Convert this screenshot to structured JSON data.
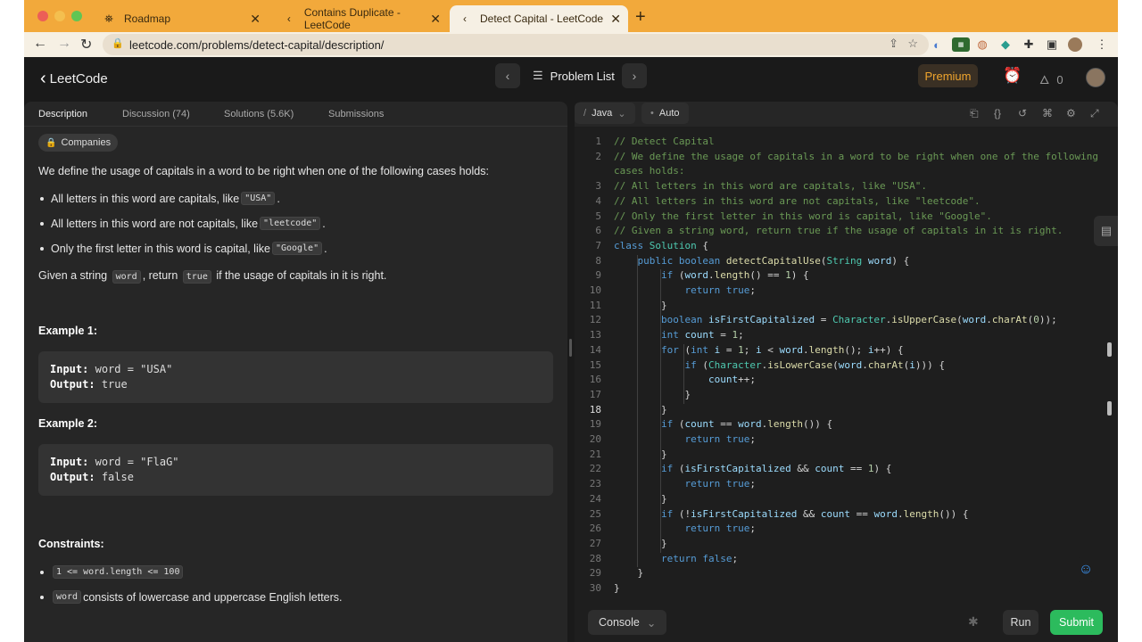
{
  "browser": {
    "tabs": [
      {
        "title": "Roadmap",
        "icon": "roadmap-icon"
      },
      {
        "title": "Contains Duplicate - LeetCode",
        "icon": "leetcode-icon"
      },
      {
        "title": "Detect Capital - LeetCode",
        "icon": "leetcode-icon",
        "active": true
      }
    ],
    "url": "leetcode.com/problems/detect-capital/description/"
  },
  "nav": {
    "logo": "LeetCode",
    "problem_list": "Problem List",
    "premium": "Premium",
    "streak": "0"
  },
  "description": {
    "tabs": [
      "Description",
      "Discussion (74)",
      "Solutions (5.6K)",
      "Submissions"
    ],
    "companies": "Companies",
    "intro": "We define the usage of capitals in a word to be right when one of the following cases holds:",
    "bullets": [
      {
        "pre": "All letters in this word are capitals, like ",
        "code": "\"USA\"",
        "post": "."
      },
      {
        "pre": "All letters in this word are not capitals, like ",
        "code": "\"leetcode\"",
        "post": "."
      },
      {
        "pre": "Only the first letter in this word is capital, like ",
        "code": "\"Google\"",
        "post": "."
      }
    ],
    "given": {
      "pre": "Given a string ",
      "code1": "word",
      "mid": ", return ",
      "code2": "true",
      "post": " if the usage of capitals in it is right."
    },
    "example1": {
      "title": "Example 1:",
      "input_label": "Input:",
      "input": "word = \"USA\"",
      "output_label": "Output:",
      "output": "true"
    },
    "example2": {
      "title": "Example 2:",
      "input_label": "Input:",
      "input": "word = \"FlaG\"",
      "output_label": "Output:",
      "output": "false"
    },
    "constraints": {
      "title": "Constraints:",
      "c1": "1 <= word.length <= 100",
      "c2_code": "word",
      "c2_text": " consists of lowercase and uppercase English letters."
    }
  },
  "editor": {
    "language": "Java",
    "auto": "Auto",
    "current_line": 18,
    "console": "Console",
    "run": "Run",
    "submit": "Submit",
    "accent_submit": "#2cbb5d",
    "lines": [
      {
        "n": "1",
        "t": "// Detect Capital"
      },
      {
        "n": "2",
        "t": "// We define the usage of capitals in a word to be right when one of the following"
      },
      {
        "n": "",
        "t": "cases holds:"
      },
      {
        "n": "3",
        "t": "// All letters in this word are capitals, like \"USA\"."
      },
      {
        "n": "4",
        "t": "// All letters in this word are not capitals, like \"leetcode\"."
      },
      {
        "n": "5",
        "t": "// Only the first letter in this word is capital, like \"Google\"."
      },
      {
        "n": "6",
        "t": "// Given a string word, return true if the usage of capitals in it is right."
      },
      {
        "n": "7",
        "t": "class Solution {"
      },
      {
        "n": "8",
        "t": "    public boolean detectCapitalUse(String word) {"
      },
      {
        "n": "9",
        "t": "        if (word.length() == 1) {"
      },
      {
        "n": "10",
        "t": "            return true;"
      },
      {
        "n": "11",
        "t": "        }"
      },
      {
        "n": "12",
        "t": "        boolean isFirstCapitalized = Character.isUpperCase(word.charAt(0));"
      },
      {
        "n": "13",
        "t": "        int count = 1;"
      },
      {
        "n": "14",
        "t": "        for (int i = 1; i < word.length(); i++) {"
      },
      {
        "n": "15",
        "t": "            if (Character.isLowerCase(word.charAt(i))) {"
      },
      {
        "n": "16",
        "t": "                count++;"
      },
      {
        "n": "17",
        "t": "            }"
      },
      {
        "n": "18",
        "t": "        }"
      },
      {
        "n": "19",
        "t": "        if (count == word.length()) {"
      },
      {
        "n": "20",
        "t": "            return true;"
      },
      {
        "n": "21",
        "t": "        }"
      },
      {
        "n": "22",
        "t": "        if (isFirstCapitalized && count == 1) {"
      },
      {
        "n": "23",
        "t": "            return true;"
      },
      {
        "n": "24",
        "t": "        }"
      },
      {
        "n": "25",
        "t": "        if (!isFirstCapitalized && count == word.length()) {"
      },
      {
        "n": "26",
        "t": "            return true;"
      },
      {
        "n": "27",
        "t": "        }"
      },
      {
        "n": "28",
        "t": "        return false;"
      },
      {
        "n": "29",
        "t": "    }"
      },
      {
        "n": "30",
        "t": "}"
      }
    ]
  }
}
